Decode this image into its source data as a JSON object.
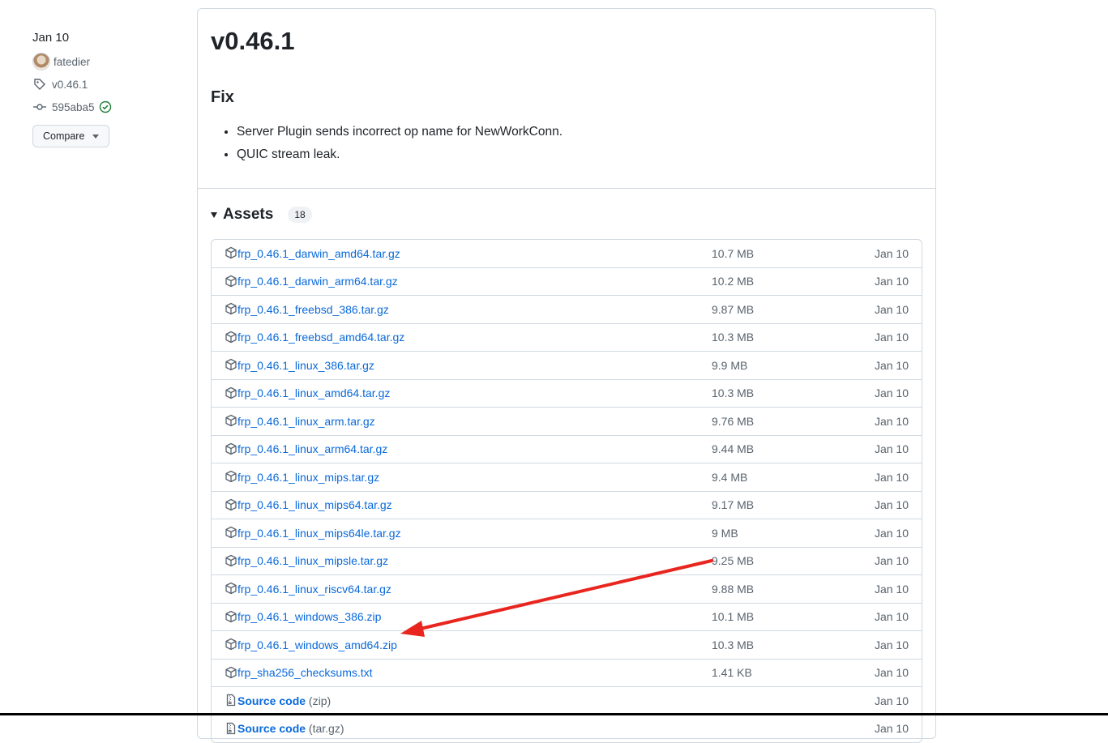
{
  "sidebar": {
    "date": "Jan 10",
    "author": "fatedier",
    "tag": "v0.46.1",
    "commit": "595aba5",
    "compare_label": "Compare"
  },
  "release": {
    "title": "v0.46.1",
    "section_heading": "Fix",
    "notes": [
      "Server Plugin sends incorrect op name for NewWorkConn.",
      "QUIC stream leak."
    ]
  },
  "assets": {
    "title": "Assets",
    "count": "18",
    "items": [
      {
        "name": "frp_0.46.1_darwin_amd64.tar.gz",
        "size": "10.7 MB",
        "date": "Jan 10"
      },
      {
        "name": "frp_0.46.1_darwin_arm64.tar.gz",
        "size": "10.2 MB",
        "date": "Jan 10"
      },
      {
        "name": "frp_0.46.1_freebsd_386.tar.gz",
        "size": "9.87 MB",
        "date": "Jan 10"
      },
      {
        "name": "frp_0.46.1_freebsd_amd64.tar.gz",
        "size": "10.3 MB",
        "date": "Jan 10"
      },
      {
        "name": "frp_0.46.1_linux_386.tar.gz",
        "size": "9.9 MB",
        "date": "Jan 10"
      },
      {
        "name": "frp_0.46.1_linux_amd64.tar.gz",
        "size": "10.3 MB",
        "date": "Jan 10"
      },
      {
        "name": "frp_0.46.1_linux_arm.tar.gz",
        "size": "9.76 MB",
        "date": "Jan 10"
      },
      {
        "name": "frp_0.46.1_linux_arm64.tar.gz",
        "size": "9.44 MB",
        "date": "Jan 10"
      },
      {
        "name": "frp_0.46.1_linux_mips.tar.gz",
        "size": "9.4 MB",
        "date": "Jan 10"
      },
      {
        "name": "frp_0.46.1_linux_mips64.tar.gz",
        "size": "9.17 MB",
        "date": "Jan 10"
      },
      {
        "name": "frp_0.46.1_linux_mips64le.tar.gz",
        "size": "9 MB",
        "date": "Jan 10"
      },
      {
        "name": "frp_0.46.1_linux_mipsle.tar.gz",
        "size": "9.25 MB",
        "date": "Jan 10"
      },
      {
        "name": "frp_0.46.1_linux_riscv64.tar.gz",
        "size": "9.88 MB",
        "date": "Jan 10"
      },
      {
        "name": "frp_0.46.1_windows_386.zip",
        "size": "10.1 MB",
        "date": "Jan 10"
      },
      {
        "name": "frp_0.46.1_windows_amd64.zip",
        "size": "10.3 MB",
        "date": "Jan 10"
      },
      {
        "name": "frp_sha256_checksums.txt",
        "size": "1.41 KB",
        "date": "Jan 10"
      }
    ],
    "source_items": [
      {
        "name": "Source code",
        "format": "(zip)",
        "date": "Jan 10"
      },
      {
        "name": "Source code",
        "format": "(tar.gz)",
        "date": "Jan 10"
      }
    ]
  },
  "colors": {
    "link": "#0969da",
    "annotation_arrow": "#e8261f",
    "verified": "#1a7f37"
  }
}
